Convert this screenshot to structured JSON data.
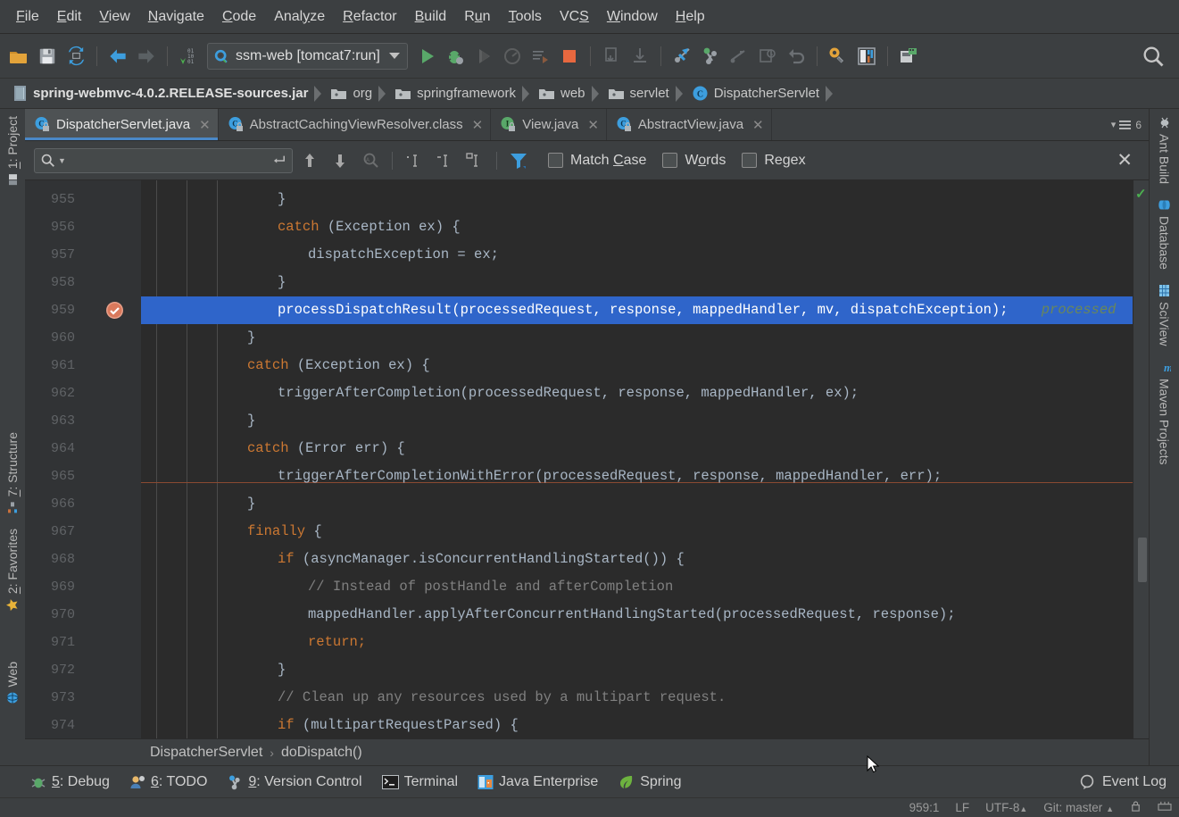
{
  "menubar": {
    "items": [
      {
        "label": "File",
        "mnemonic": "F"
      },
      {
        "label": "Edit",
        "mnemonic": "E"
      },
      {
        "label": "View",
        "mnemonic": "V"
      },
      {
        "label": "Navigate",
        "mnemonic": "N"
      },
      {
        "label": "Code",
        "mnemonic": "C"
      },
      {
        "label": "Analyze",
        "mnemonic": "y"
      },
      {
        "label": "Refactor",
        "mnemonic": "R"
      },
      {
        "label": "Build",
        "mnemonic": "B"
      },
      {
        "label": "Run",
        "mnemonic": "u"
      },
      {
        "label": "Tools",
        "mnemonic": "T"
      },
      {
        "label": "VCS",
        "mnemonic": "S"
      },
      {
        "label": "Window",
        "mnemonic": "W"
      },
      {
        "label": "Help",
        "mnemonic": "H"
      }
    ]
  },
  "toolbar": {
    "run_config": "ssm-web [tomcat7:run]",
    "buttons": [
      "open-project-icon",
      "save-all-icon",
      "sync-icon",
      "back-icon",
      "forward-icon",
      "compile-icon",
      "run-icon",
      "debug-icon",
      "run-coverage-icon",
      "profile-icon",
      "run-with-args-icon",
      "stop-icon",
      "step-into-icon",
      "step-out-icon",
      "update-project-icon",
      "commit-icon",
      "push-icon",
      "history-icon",
      "revert-icon",
      "settings-icon",
      "project-structure-icon",
      "database-sync-icon",
      "search-everywhere-icon"
    ]
  },
  "breadcrumb": {
    "items": [
      {
        "label": "spring-webmvc-4.0.2.RELEASE-sources.jar",
        "icon": "jar-icon",
        "bold": true
      },
      {
        "label": "org",
        "icon": "folder-icon",
        "bold": false
      },
      {
        "label": "springframework",
        "icon": "folder-icon",
        "bold": false
      },
      {
        "label": "web",
        "icon": "folder-icon",
        "bold": false
      },
      {
        "label": "servlet",
        "icon": "folder-icon",
        "bold": false
      },
      {
        "label": "DispatcherServlet",
        "icon": "class-icon",
        "bold": false
      }
    ]
  },
  "editor_tabs": {
    "tabs": [
      {
        "label": "DispatcherServlet.java",
        "icon": "class-locked-icon",
        "active": true
      },
      {
        "label": "AbstractCachingViewResolver.class",
        "icon": "class-locked-icon",
        "active": false
      },
      {
        "label": "View.java",
        "icon": "interface-locked-icon",
        "active": false
      },
      {
        "label": "AbstractView.java",
        "icon": "class-locked-icon",
        "active": false
      }
    ],
    "tab_count": "6"
  },
  "findbar": {
    "search_value": "",
    "search_placeholder": "",
    "checkboxes": [
      {
        "label": "Match Case",
        "mnemonic": "C",
        "checked": false
      },
      {
        "label": "Words",
        "mnemonic": "o",
        "checked": false
      },
      {
        "label": "Regex",
        "mnemonic": "",
        "checked": false
      }
    ],
    "close_label": "✕"
  },
  "sidebar_left": {
    "items": [
      {
        "label": "1: Project",
        "mnemonic": "1",
        "icon": "project-icon"
      },
      {
        "label": "7: Structure",
        "mnemonic": "7",
        "icon": "structure-icon"
      },
      {
        "label": "2: Favorites",
        "mnemonic": "2",
        "icon": "star-icon"
      },
      {
        "label": "Web",
        "mnemonic": "",
        "icon": "web-icon"
      }
    ]
  },
  "sidebar_right": {
    "items": [
      {
        "label": "Ant Build",
        "icon": "ant-icon"
      },
      {
        "label": "Database",
        "icon": "database-icon"
      },
      {
        "label": "SciView",
        "icon": "sciview-icon"
      },
      {
        "label": "Maven Projects",
        "icon": "maven-icon"
      }
    ]
  },
  "editor": {
    "first_line_number": 955,
    "highlight_line": 959,
    "lines": [
      {
        "num": 955,
        "indent": 4,
        "tokens": [
          {
            "t": "}",
            "c": "tok-plain"
          }
        ]
      },
      {
        "num": 956,
        "indent": 4,
        "tokens": [
          {
            "t": "catch",
            "c": "tok-kw"
          },
          {
            "t": " (Exception ex) {",
            "c": "tok-plain"
          }
        ]
      },
      {
        "num": 957,
        "indent": 5,
        "tokens": [
          {
            "t": "dispatchException = ex;",
            "c": "tok-plain"
          }
        ]
      },
      {
        "num": 958,
        "indent": 4,
        "tokens": [
          {
            "t": "}",
            "c": "tok-plain"
          }
        ]
      },
      {
        "num": 959,
        "indent": 4,
        "tokens": [
          {
            "t": "processDispatchResult(processedRequest, response, mappedHandler, mv, dispatchException);",
            "c": "tok-plain"
          },
          {
            "t": "    processed",
            "c": "tok-hint"
          }
        ]
      },
      {
        "num": 960,
        "indent": 3,
        "tokens": [
          {
            "t": "}",
            "c": "tok-plain"
          }
        ]
      },
      {
        "num": 961,
        "indent": 3,
        "tokens": [
          {
            "t": "catch",
            "c": "tok-kw"
          },
          {
            "t": " (Exception ex) {",
            "c": "tok-plain"
          }
        ]
      },
      {
        "num": 962,
        "indent": 4,
        "tokens": [
          {
            "t": "triggerAfterCompletion(processedRequest, response, mappedHandler, ex);",
            "c": "tok-plain"
          }
        ]
      },
      {
        "num": 963,
        "indent": 3,
        "tokens": [
          {
            "t": "}",
            "c": "tok-plain"
          }
        ]
      },
      {
        "num": 964,
        "indent": 3,
        "tokens": [
          {
            "t": "catch",
            "c": "tok-kw"
          },
          {
            "t": " (Error err) {",
            "c": "tok-plain"
          }
        ]
      },
      {
        "num": 965,
        "indent": 4,
        "tokens": [
          {
            "t": "triggerAfterCompletionWithError(processedRequest, response, mappedHandler, err);",
            "c": "tok-plain"
          }
        ]
      },
      {
        "num": 966,
        "indent": 3,
        "tokens": [
          {
            "t": "}",
            "c": "tok-plain"
          }
        ]
      },
      {
        "num": 967,
        "indent": 3,
        "tokens": [
          {
            "t": "finally",
            "c": "tok-kw"
          },
          {
            "t": " {",
            "c": "tok-plain"
          }
        ]
      },
      {
        "num": 968,
        "indent": 4,
        "tokens": [
          {
            "t": "if",
            "c": "tok-kw"
          },
          {
            "t": " (asyncManager.isConcurrentHandlingStarted()) {",
            "c": "tok-plain"
          }
        ]
      },
      {
        "num": 969,
        "indent": 5,
        "tokens": [
          {
            "t": "// Instead of postHandle and afterCompletion",
            "c": "tok-comment"
          }
        ]
      },
      {
        "num": 970,
        "indent": 5,
        "tokens": [
          {
            "t": "mappedHandler.applyAfterConcurrentHandlingStarted(processedRequest, response);",
            "c": "tok-plain"
          }
        ]
      },
      {
        "num": 971,
        "indent": 5,
        "tokens": [
          {
            "t": "return;",
            "c": "tok-kw"
          }
        ]
      },
      {
        "num": 972,
        "indent": 4,
        "tokens": [
          {
            "t": "}",
            "c": "tok-plain"
          }
        ]
      },
      {
        "num": 973,
        "indent": 4,
        "tokens": [
          {
            "t": "// Clean up any resources used by a multipart request.",
            "c": "tok-comment"
          }
        ]
      },
      {
        "num": 974,
        "indent": 4,
        "tokens": [
          {
            "t": "if",
            "c": "tok-kw"
          },
          {
            "t": " (multipartRequestParsed) {",
            "c": "tok-plain"
          }
        ]
      }
    ]
  },
  "editor_breadcrumb": {
    "class": "DispatcherServlet",
    "separator": "›",
    "method": "doDispatch()"
  },
  "bottom_bar": {
    "items": [
      {
        "label": "5: Debug",
        "mnemonic": "5",
        "icon": "debug-icon"
      },
      {
        "label": "6: TODO",
        "mnemonic": "6",
        "icon": "todo-icon"
      },
      {
        "label": "9: Version Control",
        "mnemonic": "9",
        "icon": "vcs-icon"
      },
      {
        "label": "Terminal",
        "mnemonic": "",
        "icon": "terminal-icon"
      },
      {
        "label": "Java Enterprise",
        "mnemonic": "",
        "icon": "javaee-icon"
      },
      {
        "label": "Spring",
        "mnemonic": "",
        "icon": "spring-leaf-icon"
      }
    ],
    "event_log": "Event Log"
  },
  "statusbar": {
    "caret": "959:1",
    "line_separator": "LF",
    "encoding": "UTF-8",
    "branch": "Git: master",
    "lock": "lock-icon",
    "mem": "memory-icon"
  },
  "colors": {
    "bg_chrome": "#3c3f41",
    "bg_editor": "#2b2b2b",
    "gutter": "#313335",
    "accent_blue": "#4a88c7",
    "highlight_line": "#2f65ca",
    "keyword": "#cc7832",
    "comment": "#808080",
    "hint": "#6a8759",
    "text": "#a9b7c6"
  }
}
